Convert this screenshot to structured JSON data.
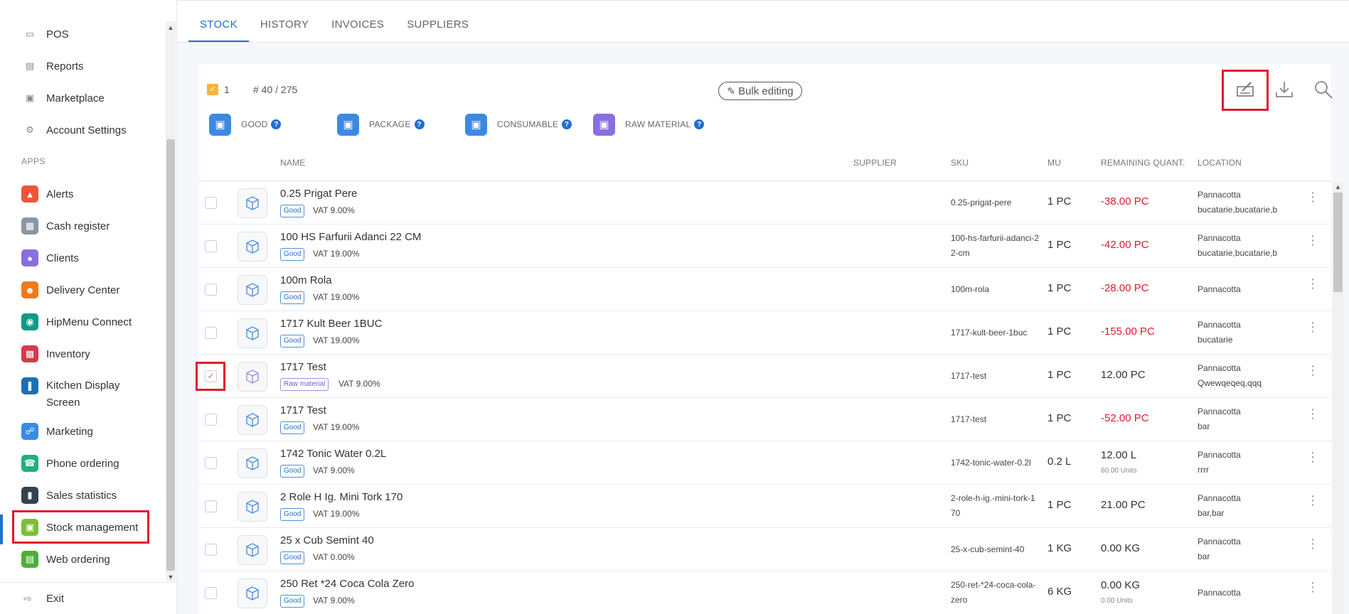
{
  "sidebar": {
    "top_items": [
      {
        "label": "POS",
        "icon": "monitor-icon"
      },
      {
        "label": "Reports",
        "icon": "chart-icon"
      },
      {
        "label": "Marketplace",
        "icon": "cart-icon"
      },
      {
        "label": "Account Settings",
        "icon": "gear-icon"
      }
    ],
    "apps_heading": "APPS",
    "apps": [
      {
        "label": "Alerts",
        "icon": "bell-icon",
        "color": "#f0553b"
      },
      {
        "label": "Cash register",
        "icon": "cash-register-icon",
        "color": "#8a96a3"
      },
      {
        "label": "Clients",
        "icon": "users-icon",
        "color": "#8a6ee0"
      },
      {
        "label": "Delivery Center",
        "icon": "delivery-person-icon",
        "color": "#f07a1a"
      },
      {
        "label": "HipMenu Connect",
        "icon": "hipmenu-icon",
        "color": "#0f9a86"
      },
      {
        "label": "Inventory",
        "icon": "inventory-icon",
        "color": "#d63a4a"
      },
      {
        "label": "Kitchen Display Screen",
        "icon": "utensils-icon",
        "color": "#1a6fb5"
      },
      {
        "label": "Marketing",
        "icon": "marketing-icon",
        "color": "#3a8be0"
      },
      {
        "label": "Phone ordering",
        "icon": "phone-icon",
        "color": "#22b07a"
      },
      {
        "label": "Sales statistics",
        "icon": "statistics-icon",
        "color": "#36424f"
      },
      {
        "label": "Stock management",
        "icon": "stock-icon",
        "color": "#7bbf3a"
      },
      {
        "label": "Web ordering",
        "icon": "web-icon",
        "color": "#4caf3a"
      }
    ],
    "exit_label": "Exit"
  },
  "tabs": [
    "STOCK",
    "HISTORY",
    "INVOICES",
    "SUPPLIERS"
  ],
  "toolbar": {
    "selected_count": "1",
    "record_count": "# 40 / 275",
    "bulk_label": "Bulk editing"
  },
  "legend": [
    "GOOD",
    "PACKAGE",
    "CONSUMABLE",
    "RAW MATERIAL"
  ],
  "legend_colors": [
    "#3a8be0",
    "#3a8be0",
    "#3a8be0",
    "#8a6ee0"
  ],
  "columns": {
    "name": "NAME",
    "supplier": "SUPPLIER",
    "sku": "SKU",
    "mu": "MU",
    "remaining": "REMAINING QUANT.",
    "location": "LOCATION"
  },
  "rows": [
    {
      "name": "0.25 Prigat Pere",
      "type": "Good",
      "vat": "VAT 9.00%",
      "sku": "0.25-prigat-pere",
      "mu": "1 PC",
      "qty": "-38.00 PC",
      "sub": "",
      "loc1": "Pannacotta",
      "loc2": "bucatarie,bucatarie,b",
      "checked": false
    },
    {
      "name": "100 HS Farfurii Adanci 22 CM",
      "type": "Good",
      "vat": "VAT 19.00%",
      "sku": "100-hs-farfurii-adanci-22-cm",
      "mu": "1 PC",
      "qty": "-42.00 PC",
      "sub": "",
      "loc1": "Pannacotta",
      "loc2": "bucatarie,bucatarie,b",
      "checked": false
    },
    {
      "name": "100m Rola",
      "type": "Good",
      "vat": "VAT 19.00%",
      "sku": "100m-rola",
      "mu": "1 PC",
      "qty": "-28.00 PC",
      "sub": "",
      "loc1": "Pannacotta",
      "loc2": "",
      "checked": false
    },
    {
      "name": "1717 Kult Beer 1BUC",
      "type": "Good",
      "vat": "VAT 19.00%",
      "sku": "1717-kult-beer-1buc",
      "mu": "1 PC",
      "qty": "-155.00 PC",
      "sub": "",
      "loc1": "Pannacotta",
      "loc2": "bucatarie",
      "checked": false
    },
    {
      "name": "1717 Test",
      "type": "Raw material",
      "vat": "VAT 9.00%",
      "sku": "1717-test",
      "mu": "1 PC",
      "qty": "12.00 PC",
      "sub": "",
      "loc1": "Pannacotta",
      "loc2": "Qwewqeqeq,qqq",
      "checked": true
    },
    {
      "name": "1717 Test",
      "type": "Good",
      "vat": "VAT 19.00%",
      "sku": "1717-test",
      "mu": "1 PC",
      "qty": "-52.00 PC",
      "sub": "",
      "loc1": "Pannacotta",
      "loc2": "bar",
      "checked": false
    },
    {
      "name": "1742 Tonic Water 0.2L",
      "type": "Good",
      "vat": "VAT 9.00%",
      "sku": "1742-tonic-water-0.2l",
      "mu": "0.2 L",
      "qty": "12.00 L",
      "sub": "60.00 Units",
      "loc1": "Pannacotta",
      "loc2": "rrrr",
      "checked": false
    },
    {
      "name": "2 Role H Ig. Mini Tork 170",
      "type": "Good",
      "vat": "VAT 19.00%",
      "sku": "2-role-h-ig.-mini-tork-170",
      "mu": "1 PC",
      "qty": "21.00 PC",
      "sub": "",
      "loc1": "Pannacotta",
      "loc2": "bar,bar",
      "checked": false
    },
    {
      "name": "25 x Cub Semint 40",
      "type": "Good",
      "vat": "VAT 0.00%",
      "sku": "25-x-cub-semint-40",
      "mu": "1 KG",
      "qty": "0.00 KG",
      "sub": "",
      "loc1": "Pannacotta",
      "loc2": "bar",
      "checked": false
    },
    {
      "name": "250 Ret *24 Coca Cola Zero",
      "type": "Good",
      "vat": "VAT 9.00%",
      "sku": "250-ret-*24-coca-cola-zero",
      "mu": "6 KG",
      "qty": "0.00 KG",
      "sub": "0.00 Units",
      "loc1": "Pannacotta",
      "loc2": "",
      "checked": false
    }
  ],
  "colors": {
    "accent": "#1f6fd1",
    "negative": "#e3172b",
    "highlight": "#e3172b",
    "selected_check": "#f6b53b"
  }
}
